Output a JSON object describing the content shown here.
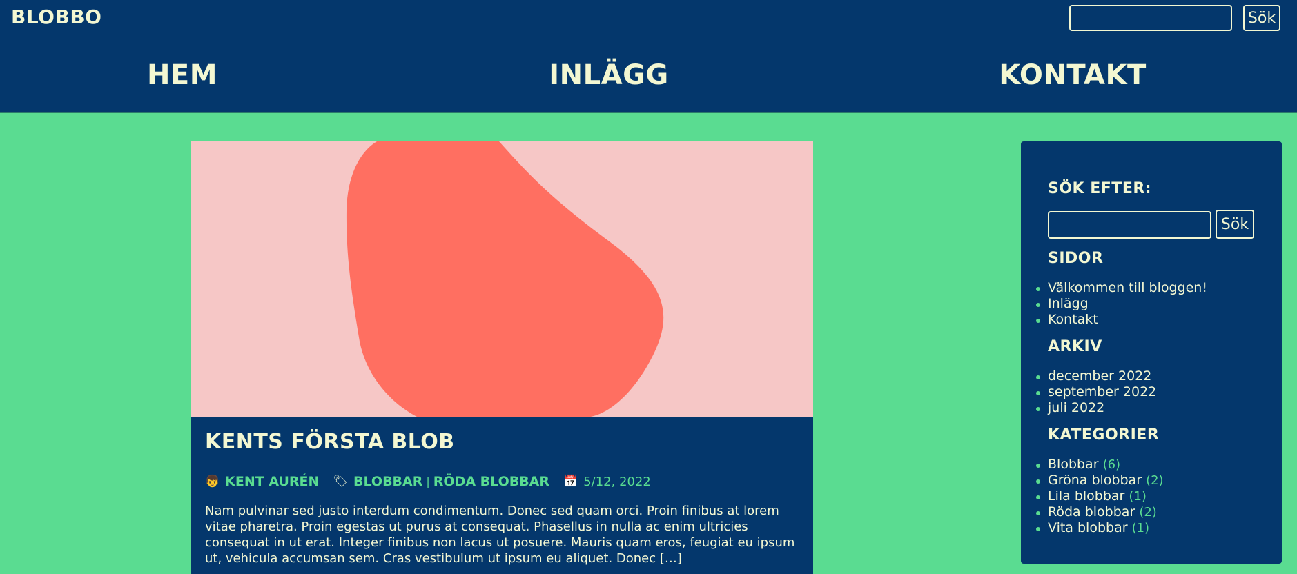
{
  "header": {
    "logo": "BLOBBO",
    "search_button": "Sök",
    "search_value": "",
    "nav": [
      {
        "label": "HEM"
      },
      {
        "label": "INLÄGG"
      },
      {
        "label": "KONTAKT"
      }
    ]
  },
  "post": {
    "title": "KENTS FÖRSTA BLOB",
    "author": "KENT AURÉN",
    "categories": [
      "BLOBBAR",
      "RÖDA BLOBBAR"
    ],
    "category_separator": "|",
    "date": "5/12, 2022",
    "author_icon": "person-emoji-icon",
    "category_icon": "label-tag-icon",
    "date_icon": "calendar-icon",
    "excerpt": "Nam pulvinar sed justo interdum condimentum. Donec sed quam orci. Proin finibus at lorem vitae pharetra. Proin egestas ut purus at consequat. Phasellus in nulla ac enim ultricies consequat in ut erat. Integer finibus non lacus ut posuere. Mauris quam eros, feugiat eu ipsum ut, vehicula accumsan sem. Cras vestibulum ut ipsum eu aliquet. Donec […]"
  },
  "sidebar": {
    "search_heading": "SÖK EFTER:",
    "search_button": "Sök",
    "search_value": "",
    "pages_heading": "SIDOR",
    "pages": [
      {
        "label": "Välkommen till bloggen!"
      },
      {
        "label": "Inlägg"
      },
      {
        "label": "Kontakt"
      }
    ],
    "archive_heading": "ARKIV",
    "archive": [
      {
        "label": "december 2022"
      },
      {
        "label": "september 2022"
      },
      {
        "label": "juli 2022"
      }
    ],
    "categories_heading": "KATEGORIER",
    "categories": [
      {
        "label": "Blobbar",
        "count": "(6)"
      },
      {
        "label": "Gröna blobbar",
        "count": "(2)"
      },
      {
        "label": "Lila blobbar",
        "count": "(1)"
      },
      {
        "label": "Röda blobbar",
        "count": "(2)"
      },
      {
        "label": "Vita blobbar",
        "count": "(1)"
      }
    ]
  },
  "colors": {
    "background": "#5ADC91",
    "navy": "#04376C",
    "cream": "#F3F7D2",
    "blob_bg": "#F6C7C6",
    "blob": "#FF6F61"
  }
}
